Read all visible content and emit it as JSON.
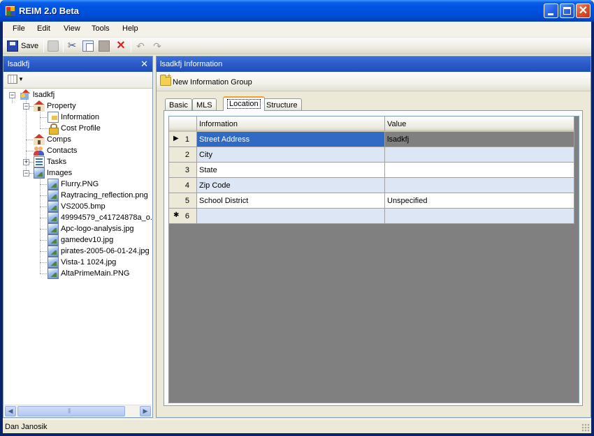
{
  "window": {
    "title": "REIM 2.0 Beta"
  },
  "menu": [
    "File",
    "Edit",
    "View",
    "Tools",
    "Help"
  ],
  "toolbar": {
    "save_label": "Save"
  },
  "left_panel": {
    "title": "lsadkfj",
    "tree": {
      "root": "lsadkfj",
      "property": "Property",
      "information": "Information",
      "cost_profile": "Cost Profile",
      "comps": "Comps",
      "contacts": "Contacts",
      "tasks": "Tasks",
      "images": "Images",
      "image_files": [
        "Flurry.PNG",
        "Raytracing_reflection.png",
        "VS2005.bmp",
        "49994579_c41724878a_o.",
        "Apc-logo-analysis.jpg",
        "gamedev10.jpg",
        "pirates-2005-06-01-24.jpg",
        "Vista-1 1024.jpg",
        "AltaPrimeMain.PNG"
      ]
    }
  },
  "right_panel": {
    "title": "lsadkfj Information",
    "new_group_label": "New Information Group",
    "tabs": [
      "Basic",
      "MLS",
      "Location",
      "Structure"
    ],
    "active_tab": "Location",
    "grid": {
      "columns": [
        "Information",
        "Value"
      ],
      "rows": [
        {
          "num": "1",
          "info": "Street Address",
          "value": "lsadkfj"
        },
        {
          "num": "2",
          "info": "City",
          "value": ""
        },
        {
          "num": "3",
          "info": "State",
          "value": ""
        },
        {
          "num": "4",
          "info": "Zip Code",
          "value": ""
        },
        {
          "num": "5",
          "info": "School District",
          "value": "Unspecified"
        },
        {
          "num": "6",
          "info": "",
          "value": ""
        }
      ],
      "current_row_marker": "▶",
      "new_row_marker": "✱"
    }
  },
  "status": {
    "text": "Dan Janosik"
  }
}
